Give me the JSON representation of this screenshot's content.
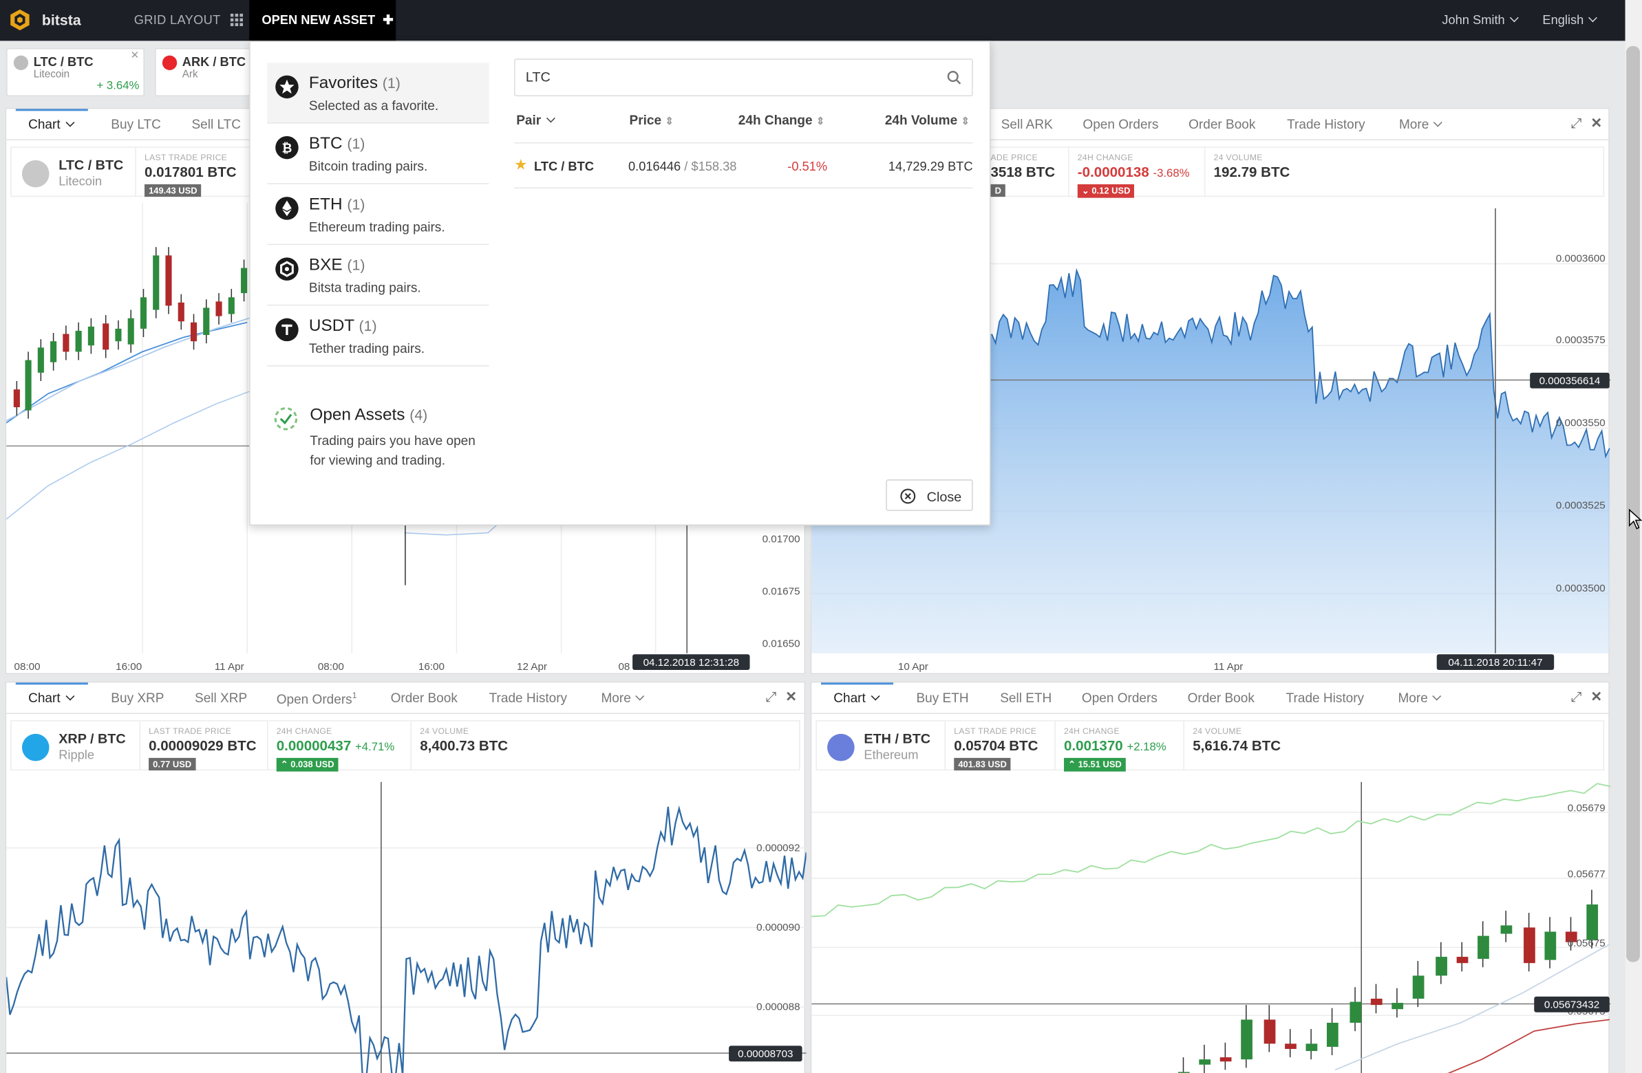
{
  "app": {
    "brand": "bitsta",
    "nav_grid_layout": "GRID LAYOUT",
    "nav_open_new_asset": "OPEN NEW ASSET",
    "user": "John Smith",
    "language": "English"
  },
  "open_tabs": [
    {
      "pair": "LTC / BTC",
      "name": "Litecoin",
      "change": "+ 3.64%"
    },
    {
      "pair": "ARK / BTC",
      "name": "Ark"
    }
  ],
  "dropdown": {
    "categories": [
      {
        "title": "Favorites",
        "count": "(1)",
        "desc": "Selected as a favorite."
      },
      {
        "title": "BTC",
        "count": "(1)",
        "desc": "Bitcoin trading pairs."
      },
      {
        "title": "ETH",
        "count": "(1)",
        "desc": "Ethereum trading pairs."
      },
      {
        "title": "BXE",
        "count": "(1)",
        "desc": "Bitsta trading pairs."
      },
      {
        "title": "USDT",
        "count": "(1)",
        "desc": "Tether trading pairs."
      }
    ],
    "open_assets": {
      "title": "Open Assets",
      "count": "(4)",
      "desc_line1": "Trading pairs you have open",
      "desc_line2": "for viewing and trading."
    },
    "search_value": "LTC",
    "columns": {
      "pair": "Pair",
      "price": "Price",
      "change": "24h Change",
      "volume": "24h Volume"
    },
    "result": {
      "pair": "LTC / BTC",
      "price": "0.016446",
      "price_usd": "$158.38",
      "change": "-0.51%",
      "volume": "14,729.29 BTC"
    },
    "close_label": "Close"
  },
  "panels": {
    "ltc": {
      "tabs": [
        "Chart",
        "Buy LTC",
        "Sell LTC"
      ],
      "pair": "LTC / BTC",
      "name": "Litecoin",
      "last_label": "LAST TRADE PRICE",
      "last_value": "0.017801 BTC",
      "last_usd": "149.43 USD",
      "y_ticks": [
        "0.01700",
        "0.01675",
        "0.01650"
      ],
      "x_ticks": [
        "08:00",
        "16:00",
        "11 Apr",
        "08:00",
        "16:00",
        "12 Apr",
        "08"
      ],
      "cursor_time": "04.12.2018 12:31:28"
    },
    "ark": {
      "tabs": [
        "Sell ARK",
        "Open Orders",
        "Order Book",
        "Trade History",
        "More"
      ],
      "last_label": "ADE PRICE",
      "last_value": "3518 BTC",
      "last_usd": "D",
      "change_label": "24H CHANGE",
      "change_value": "-0.0000138",
      "change_pct": "-3.68%",
      "change_usd": "0.12 USD",
      "vol_label": "24 VOLUME",
      "vol_value": "192.79 BTC",
      "y_ticks": [
        "0.0003600",
        "0.0003575",
        "0.0003550",
        "0.0003525",
        "0.0003500"
      ],
      "crosshair_value": "0.000356614",
      "x_ticks": [
        "10 Apr",
        "11 Apr"
      ],
      "cursor_time": "04.11.2018 20:11:47"
    },
    "xrp": {
      "tabs": [
        "Chart",
        "Buy XRP",
        "Sell XRP",
        "Open Orders",
        "Order Book",
        "Trade History",
        "More"
      ],
      "open_orders_count": "1",
      "pair": "XRP / BTC",
      "name": "Ripple",
      "last_label": "LAST TRADE PRICE",
      "last_value": "0.00009029 BTC",
      "last_usd": "0.77 USD",
      "change_label": "24H CHANGE",
      "change_value": "0.00000437",
      "change_pct": "+4.71%",
      "change_usd": "0.038 USD",
      "vol_label": "24 VOLUME",
      "vol_value": "8,400.73 BTC",
      "y_ticks": [
        "0.000092",
        "0.000090",
        "0.000088"
      ],
      "crosshair_value": "0.00008703"
    },
    "eth": {
      "tabs": [
        "Chart",
        "Buy ETH",
        "Sell ETH",
        "Open Orders",
        "Order Book",
        "Trade History",
        "More"
      ],
      "pair": "ETH / BTC",
      "name": "Ethereum",
      "last_label": "LAST TRADE PRICE",
      "last_value": "0.05704 BTC",
      "last_usd": "401.83 USD",
      "change_label": "24H CHANGE",
      "change_value": "0.001370",
      "change_pct": "+2.18%",
      "change_usd": "15.51 USD",
      "vol_label": "24 VOLUME",
      "vol_value": "5,616.74 BTC",
      "y_ticks": [
        "0.05679",
        "0.05677",
        "0.05675",
        "0.05673"
      ],
      "crosshair_value": "0.05673432"
    }
  },
  "colors": {
    "accent": "#4a90d9",
    "up": "#2e9d4c",
    "down": "#d43b3b",
    "topbar": "#1c1f26"
  }
}
